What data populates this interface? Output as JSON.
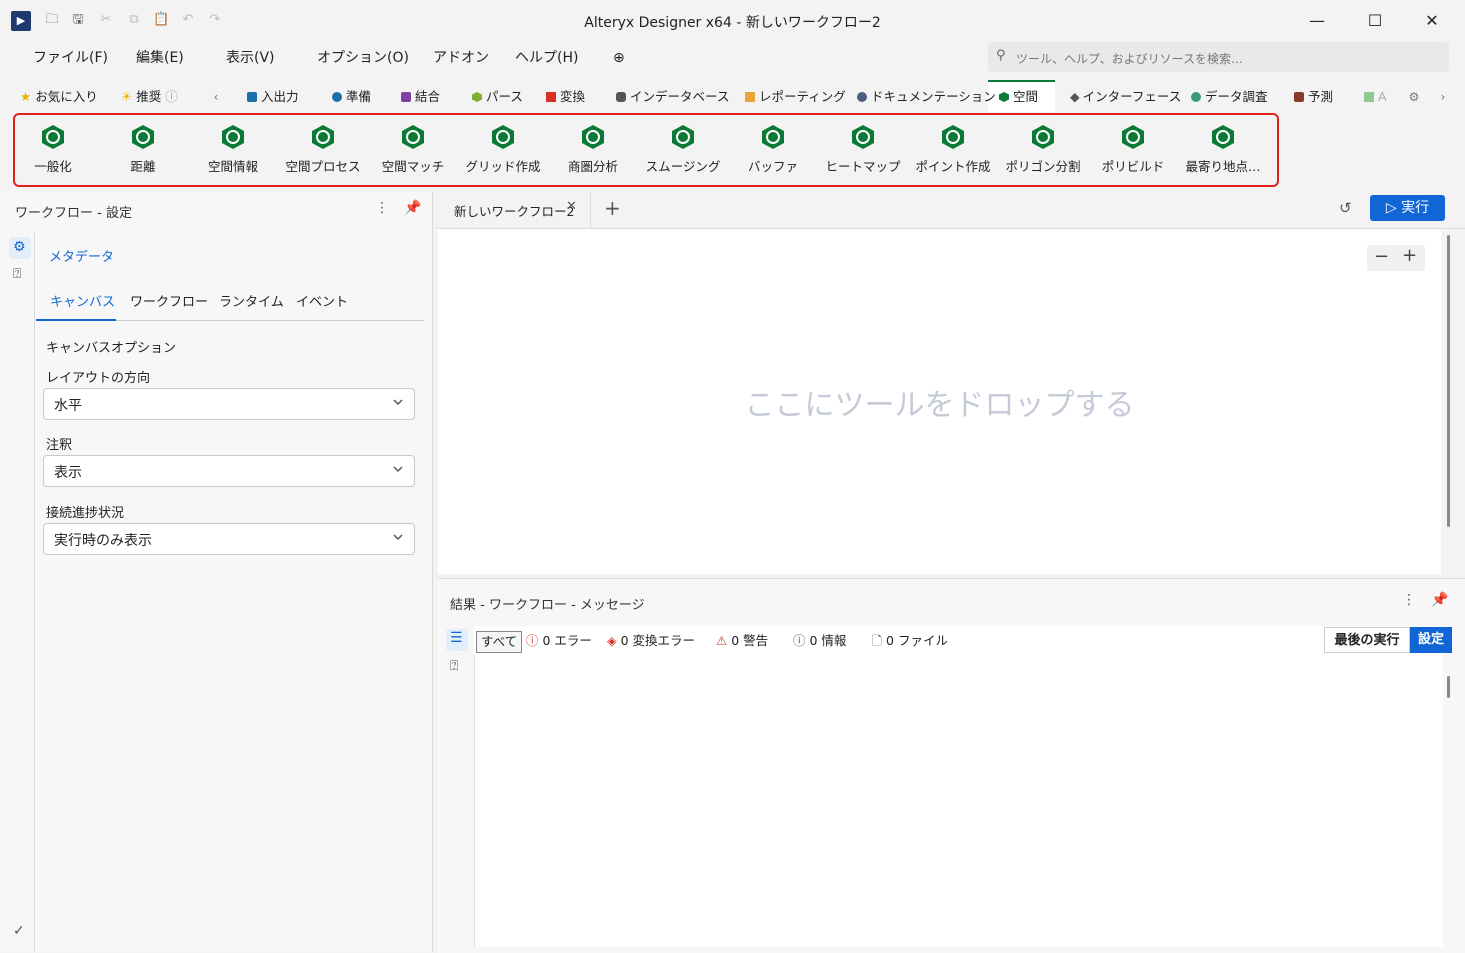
{
  "window": {
    "title": "Alteryx Designer x64 - 新しいワークフロー2",
    "minimize": "—",
    "maximize": "☐",
    "close": "✕"
  },
  "menu": [
    "ファイル(F)",
    "編集(E)",
    "表示(V)",
    "オプション(O)",
    "アドオン",
    "ヘルプ(H)"
  ],
  "search": {
    "placeholder": "ツール、ヘルプ、およびリソースを検索…"
  },
  "categories": [
    {
      "label": "お気に入り",
      "color": "#f0b400",
      "icon": "star-icon"
    },
    {
      "label": "推奨",
      "color": "#f0b400",
      "icon": "sun-icon"
    },
    {
      "label": "入出力",
      "color": "#1b6fa8"
    },
    {
      "label": "準備",
      "color": "#1b6fa8"
    },
    {
      "label": "結合",
      "color": "#7e3fa0"
    },
    {
      "label": "パース",
      "color": "#7fb031"
    },
    {
      "label": "変換",
      "color": "#d93025"
    },
    {
      "label": "インデータベース",
      "color": "#555555"
    },
    {
      "label": "レポーティング",
      "color": "#e8a53c"
    },
    {
      "label": "ドキュメンテーション",
      "color": "#4a5f80"
    },
    {
      "label": "空間",
      "color": "#0a7a36"
    },
    {
      "label": "インターフェース",
      "color": "#555555"
    },
    {
      "label": "データ調査",
      "color": "#3a9a7a"
    },
    {
      "label": "予測",
      "color": "#8b3a2a"
    },
    {
      "label": "A",
      "color": "#4caf50"
    }
  ],
  "tools": [
    "一般化",
    "距離",
    "空間情報",
    "空間プロセス",
    "空間マッチ",
    "グリッド作成",
    "商圏分析",
    "スムージング",
    "バッファ",
    "ヒートマップ",
    "ポイント作成",
    "ポリゴン分割",
    "ポリビルド",
    "最寄り地点…"
  ],
  "left_panel": {
    "header": "ワークフロー - 設定",
    "section": "メタデータ",
    "subtabs": [
      "キャンバス",
      "ワークフロー",
      "ランタイム",
      "イベント"
    ],
    "canvas_options": "キャンバスオプション",
    "layout_label": "レイアウトの方向",
    "layout_value": "水平",
    "annotation_label": "注釈",
    "annotation_value": "表示",
    "progress_label": "接続進捗状況",
    "progress_value": "実行時のみ表示"
  },
  "document": {
    "tab": "新しいワークフロー2",
    "run": "実行",
    "drop_hint": "ここにツールをドロップする"
  },
  "results": {
    "header": "結果 - ワークフロー - メッセージ",
    "filters": {
      "all": "すべて",
      "errors": "0 エラー",
      "conv_errors": "0 変換エラー",
      "warnings": "0 警告",
      "info": "0 情報",
      "files": "0 ファイル"
    },
    "last_run": "最後の実行",
    "settings": "設定"
  },
  "colors": {
    "accent": "#1166d6",
    "spatial": "#0a7a36",
    "highlight": "#e0201c"
  }
}
